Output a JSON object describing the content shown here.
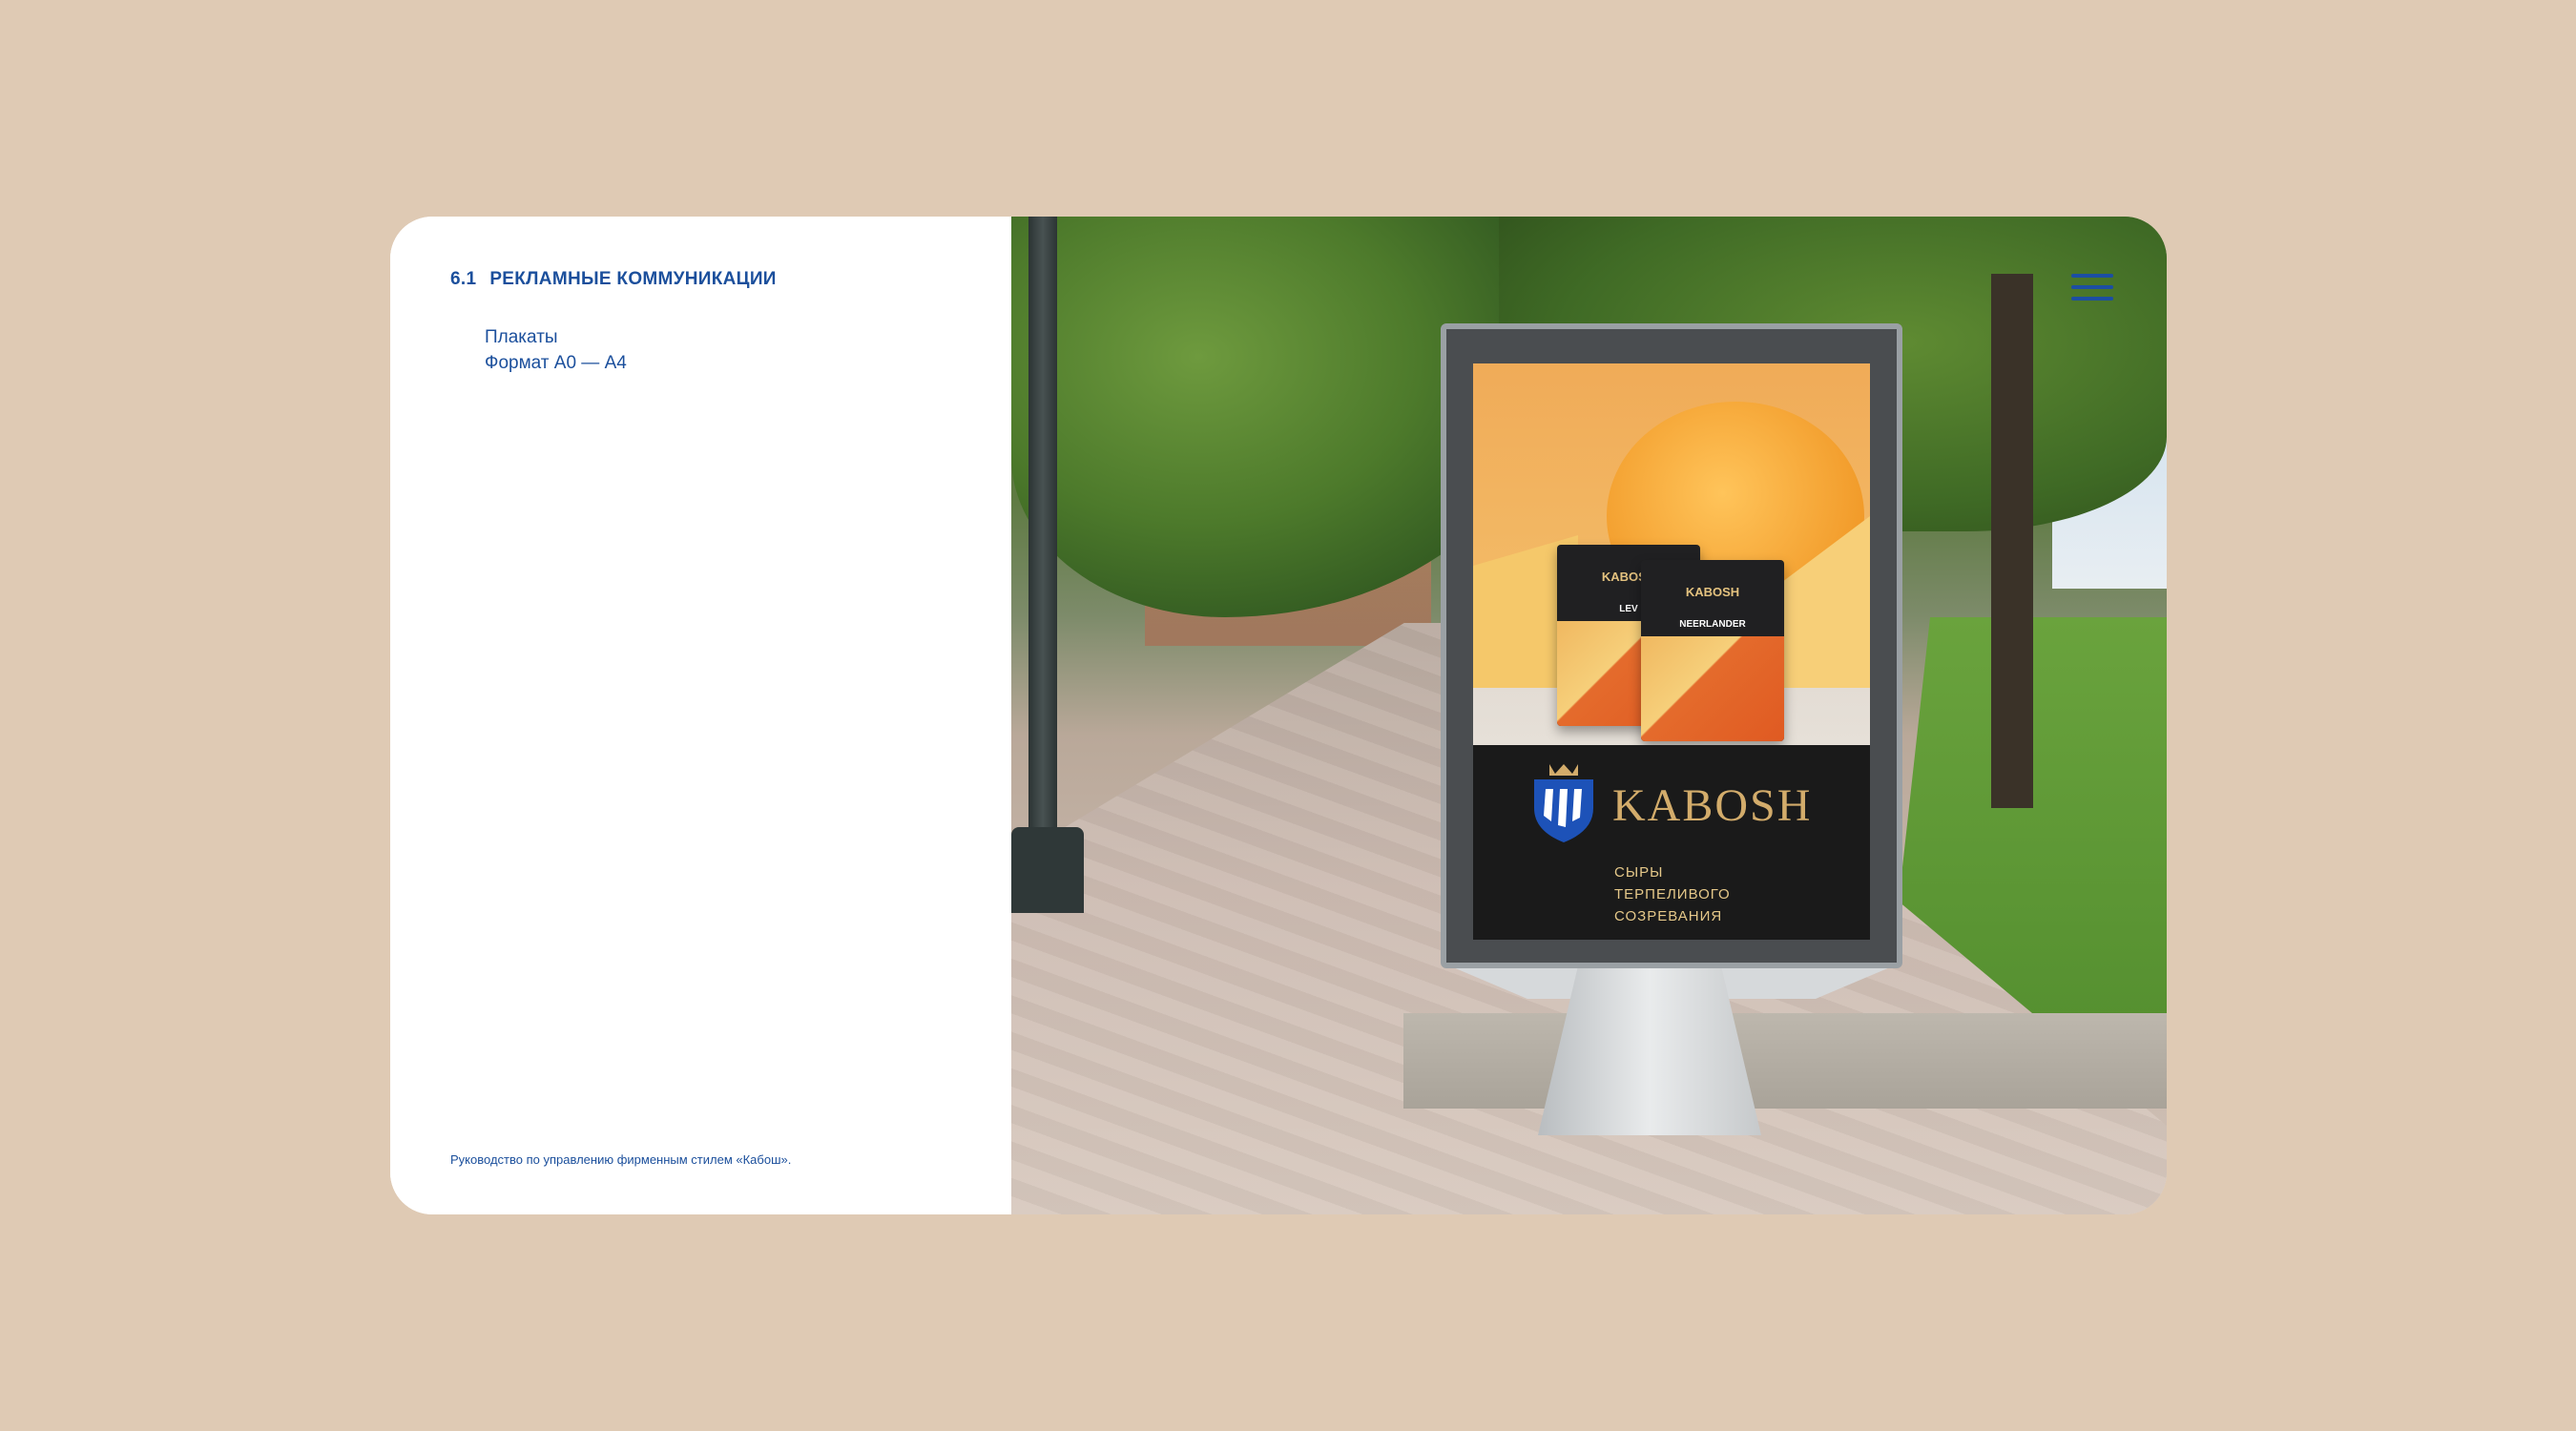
{
  "section": {
    "number": "6.1",
    "title": "РЕКЛАМНЫЕ КОММУНИКАЦИИ",
    "items": [
      "Плакаты",
      "Формат А0 — А4"
    ]
  },
  "footer": {
    "note": "Руководство по управлению фирменным стилем «Кабош»."
  },
  "poster": {
    "brand": "KABOSH",
    "tagline": [
      "СЫРЫ",
      "ТЕРПЕЛИВОГО",
      "СОЗРЕВАНИЯ"
    ],
    "packages": [
      {
        "brand": "KABOSH",
        "variety": "LEV"
      },
      {
        "brand": "KABOSH",
        "variety": "NEERLANDER"
      }
    ]
  },
  "menu": {
    "icon": "hamburger-menu-icon"
  },
  "colors": {
    "background": "#dfcab4",
    "accent": "#1b4f9c",
    "brand_gold": "#d3ac6b",
    "poster_dark": "#1a1a1a"
  }
}
